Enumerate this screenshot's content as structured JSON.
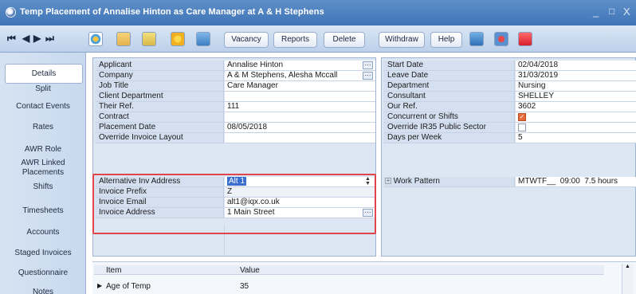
{
  "window": {
    "title": "Temp Placement of Annalise Hinton as Care Manager at A & H Stephens",
    "controls": {
      "minimize": "_",
      "maximize": "□",
      "close": "X"
    }
  },
  "toolbar": {
    "nav": {
      "first": "⏮",
      "prev": "◀",
      "next": "▶",
      "last": "⏭"
    },
    "buttons": {
      "vacancy": "Vacancy",
      "reports": "Reports",
      "delete": "Delete",
      "withdraw": "Withdraw",
      "help": "Help"
    }
  },
  "sidebar": {
    "items": [
      {
        "label": "Details"
      },
      {
        "label": "Split"
      },
      {
        "label": "Contact Events"
      },
      {
        "label": "Rates"
      },
      {
        "label": "AWR Role"
      },
      {
        "label": "AWR Linked Placements"
      },
      {
        "label": "Shifts"
      },
      {
        "label": "Timesheets"
      },
      {
        "label": "Accounts"
      },
      {
        "label": "Staged Invoices"
      },
      {
        "label": "Questionnaire"
      },
      {
        "label": "Notes"
      }
    ]
  },
  "left_grid": {
    "rows": [
      {
        "label": "Applicant",
        "value": "Annalise Hinton"
      },
      {
        "label": "Company",
        "value": "A & M Stephens, Alesha Mccall"
      },
      {
        "label": "Job Title",
        "value": "Care Manager"
      },
      {
        "label": "Client Department",
        "value": ""
      },
      {
        "label": "Their Ref.",
        "value": "111"
      },
      {
        "label": "Contract",
        "value": ""
      },
      {
        "label": "Placement Date",
        "value": "08/05/2018"
      },
      {
        "label": "Override Invoice Layout",
        "value": ""
      },
      {
        "label": "Alternative Inv Address",
        "value": "Alt 1"
      },
      {
        "label": "Invoice Prefix",
        "value": "Z"
      },
      {
        "label": "Invoice Email",
        "value": "alt1@iqx.co.uk"
      },
      {
        "label": "Invoice Address",
        "value": "1 Main Street"
      }
    ]
  },
  "right_grid": {
    "rows": [
      {
        "label": "Start Date",
        "value": "02/04/2018"
      },
      {
        "label": "Leave Date",
        "value": "31/03/2019"
      },
      {
        "label": "Department",
        "value": "Nursing"
      },
      {
        "label": "Consultant",
        "value": "SHELLEY"
      },
      {
        "label": "Our Ref.",
        "value": "3602"
      },
      {
        "label": "Concurrent or Shifts",
        "value": ""
      },
      {
        "label": "Override IR35 Public Sector",
        "value": ""
      },
      {
        "label": "Days per Week",
        "value": "5"
      },
      {
        "label": "Work Pattern",
        "value": "MTWTF__  09:00  7.5 hours"
      }
    ],
    "expander": "+"
  },
  "bottom_table": {
    "columns": [
      "Item",
      "Value"
    ],
    "rows": [
      {
        "item": "Age of Temp",
        "value": "35"
      }
    ],
    "row_marker": "▶"
  },
  "colors": {
    "title_bar": "#4a7fc1",
    "highlight": "#e0454b",
    "checkbox": "#e86a3a"
  }
}
